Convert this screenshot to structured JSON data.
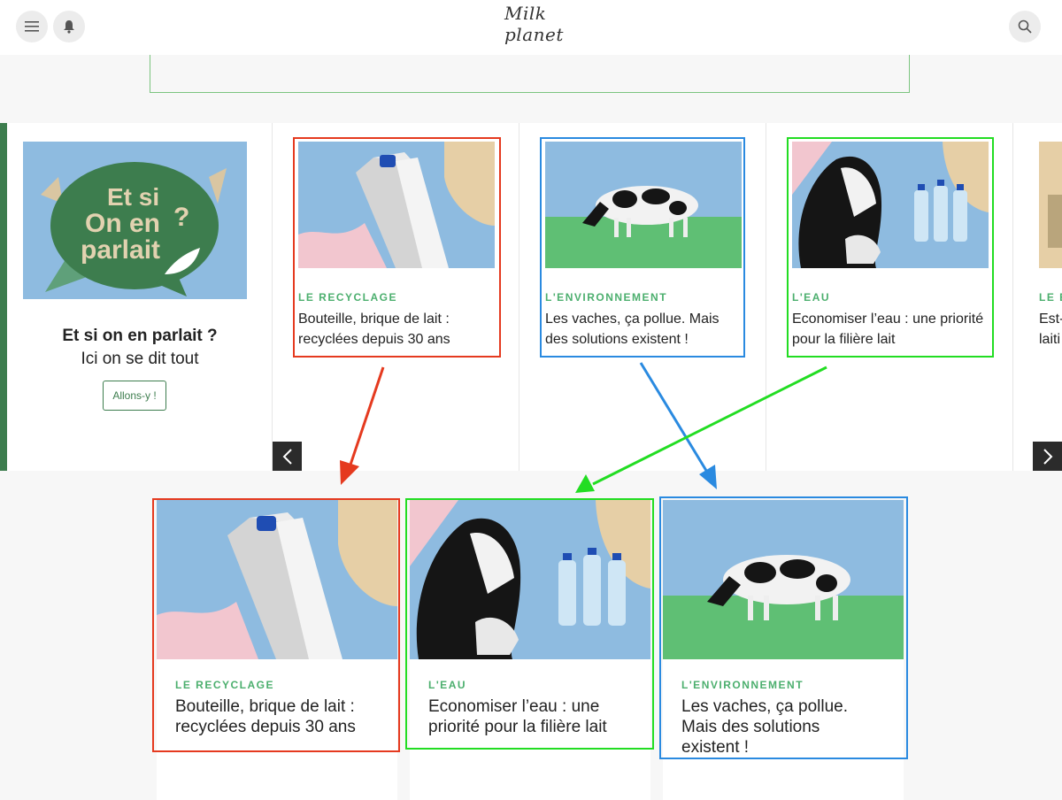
{
  "header": {
    "menu_icon": "menu-icon",
    "bell_icon": "bell-icon",
    "logo_text": "Milk planet",
    "search_icon": "search-icon"
  },
  "promo": {
    "image_text_1": "Et si",
    "image_text_2": "On en",
    "image_text_3": "parlait",
    "title": "Et si on en parlait ?",
    "subtitle": "Ici on se dit tout",
    "button_label": "Allons-y !"
  },
  "carousel": {
    "cards": [
      {
        "category": "LE RECYCLAGE",
        "title": "Bouteille, brique de lait : recyclées depuis 30 ans"
      },
      {
        "category": "L'ENVIRONNEMENT",
        "title": "Les vaches, ça pollue. Mais des solutions existent !"
      },
      {
        "category": "L'EAU",
        "title": "Economiser l’eau : une priorité pour la filière lait"
      },
      {
        "category": "LE E",
        "title": "Est-laiti"
      }
    ],
    "prev_icon": "chevron-left-icon",
    "next_icon": "chevron-right-icon"
  },
  "grid": {
    "cards": [
      {
        "category": "LE RECYCLAGE",
        "title": "Bouteille, brique de lait : recyclées depuis 30 ans"
      },
      {
        "category": "L'EAU",
        "title": "Economiser l’eau : une priorité pour la filière lait"
      },
      {
        "category": "L'ENVIRONNEMENT",
        "title": "Les vaches, ça pollue. Mais des solutions existent !"
      }
    ]
  },
  "colors": {
    "brand_green": "#3d7d4e",
    "category_green": "#4caf6e",
    "annotation_red": "#e53a1f",
    "annotation_blue": "#2a8ae0",
    "annotation_green": "#22dd22"
  }
}
